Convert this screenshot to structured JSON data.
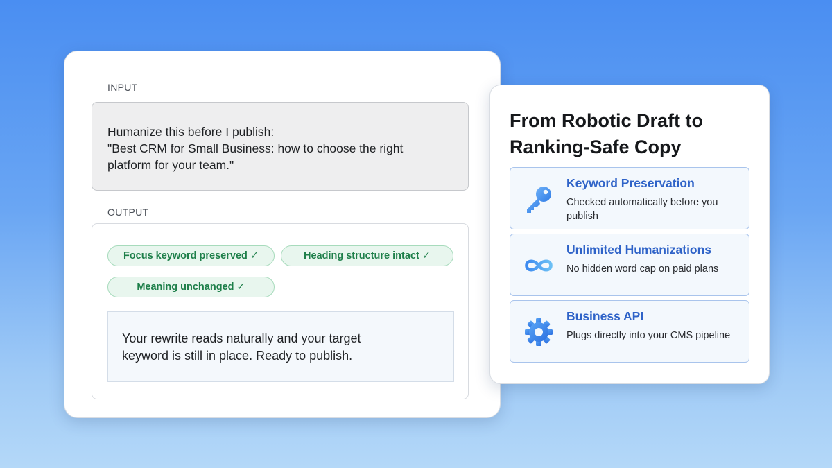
{
  "input_section": {
    "label": "INPUT",
    "prompt_line1": "Humanize this before I publish:",
    "prompt_line2": "\"Best CRM for Small Business: how to choose the right",
    "prompt_line3": "platform for your team.\""
  },
  "output_section": {
    "label": "OUTPUT",
    "checks": [
      {
        "label": "Focus keyword preserved ✓"
      },
      {
        "label": "Heading structure intact ✓"
      },
      {
        "label": "Meaning unchanged ✓"
      }
    ],
    "result_line1": "Your rewrite reads naturally and your target",
    "result_line2": "keyword is still in place. Ready to publish."
  },
  "features_panel": {
    "title": "From Robotic Draft to Ranking-Safe Copy",
    "features": [
      {
        "icon": "key-icon",
        "title": "Keyword Preservation",
        "description": "Checked automatically before you publish"
      },
      {
        "icon": "infinity-icon",
        "title": "Unlimited Humanizations",
        "description": "No hidden word cap on paid plans"
      },
      {
        "icon": "gear-icon",
        "title": "Business API",
        "description": "Plugs directly into your CMS pipeline"
      }
    ]
  },
  "colors": {
    "accent_blue": "#2f63c8",
    "check_green": "#1e7f4a",
    "background_top": "#4a8ef2",
    "background_bottom": "#b4d8f8"
  }
}
